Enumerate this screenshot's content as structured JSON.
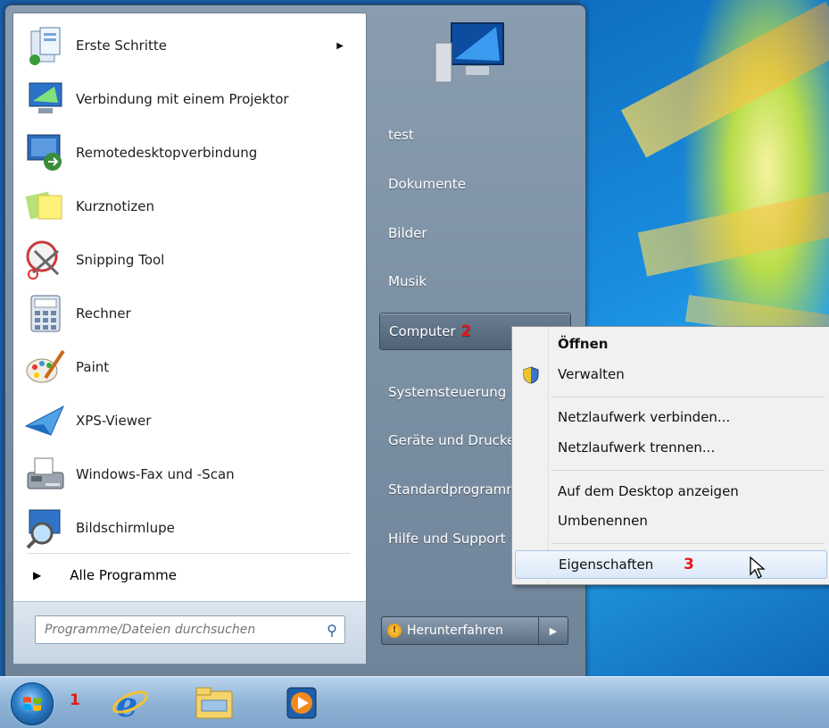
{
  "programs": [
    {
      "label": "Erste Schritte",
      "icon": "getting-started-icon",
      "has_submenu": true
    },
    {
      "label": "Verbindung mit einem Projektor",
      "icon": "projector-icon"
    },
    {
      "label": "Remotedesktopverbindung",
      "icon": "remote-desktop-icon"
    },
    {
      "label": "Kurznotizen",
      "icon": "sticky-notes-icon"
    },
    {
      "label": "Snipping Tool",
      "icon": "snipping-tool-icon"
    },
    {
      "label": "Rechner",
      "icon": "calculator-icon"
    },
    {
      "label": "Paint",
      "icon": "paint-icon"
    },
    {
      "label": "XPS-Viewer",
      "icon": "xps-viewer-icon"
    },
    {
      "label": "Windows-Fax und -Scan",
      "icon": "fax-scan-icon"
    },
    {
      "label": "Bildschirmlupe",
      "icon": "magnifier-icon"
    }
  ],
  "all_programs_label": "Alle Programme",
  "search": {
    "placeholder": "Programme/Dateien durchsuchen"
  },
  "right_panel": {
    "items": [
      "test",
      "Dokumente",
      "Bilder",
      "Musik",
      "Computer",
      "Systemsteuerung",
      "Geräte und Drucker",
      "Standardprogramme",
      "Hilfe und Support"
    ],
    "computer_step": "2",
    "shutdown_label": "Herunterfahren"
  },
  "context_menu": {
    "items": [
      "Öffnen",
      "Verwalten",
      "Netzlaufwerk verbinden...",
      "Netzlaufwerk trennen...",
      "Auf dem Desktop anzeigen",
      "Umbenennen",
      "Eigenschaften"
    ],
    "properties_step": "3"
  },
  "taskbar": {
    "start_step": "1",
    "pinned": [
      "internet-explorer-icon",
      "explorer-icon",
      "media-player-icon"
    ]
  }
}
